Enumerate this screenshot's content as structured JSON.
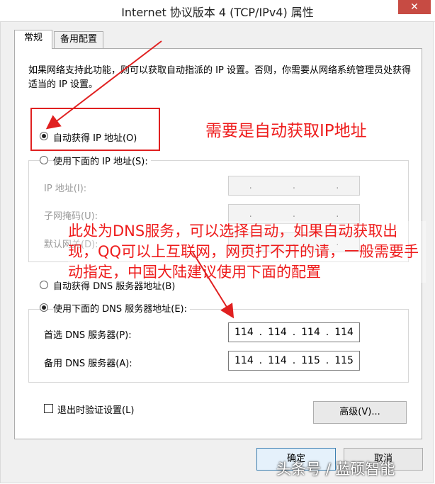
{
  "window": {
    "title": "Internet 协议版本 4 (TCP/IPv4) 属性",
    "close_glyph": "✕"
  },
  "tabs": [
    {
      "label": "常规",
      "active": true
    },
    {
      "label": "备用配置",
      "active": false
    }
  ],
  "description": "如果网络支持此功能，则可以获取自动指派的 IP 设置。否则，你需要从网络系统管理员处获得适当的 IP 设置。",
  "ip": {
    "auto_label": "自动获得 IP 地址(O)",
    "auto_selected": true,
    "manual_label": "使用下面的 IP 地址(S):",
    "manual_selected": false,
    "fields": [
      {
        "label": "IP 地址(I):",
        "value": "  .  .  ."
      },
      {
        "label": "子网掩码(U):",
        "value": "  .  .  ."
      },
      {
        "label": "默认网关(D):",
        "value": "  .  .  ."
      }
    ]
  },
  "dns": {
    "auto_label": "自动获得 DNS 服务器地址(B)",
    "auto_selected": false,
    "manual_label": "使用下面的 DNS 服务器地址(E):",
    "manual_selected": true,
    "preferred_label": "首选 DNS 服务器(P):",
    "preferred_octets": [
      "114",
      "114",
      "114",
      "114"
    ],
    "alternate_label": "备用 DNS 服务器(A):",
    "alternate_octets": [
      "114",
      "114",
      "115",
      "115"
    ]
  },
  "validate_label": "退出时验证设置(L)",
  "validate_checked": false,
  "advanced_label": "高级(V)...",
  "ok_label": "确定",
  "cancel_label": "取消",
  "annotations": {
    "top": "需要是自动获取IP地址",
    "middle": "此处为DNS服务，可以选择自动，如果自动获取出现，QQ可以上互联网，网页打不开的请，一般需要手动指定，中国大陆建议使用下面的配置",
    "color": "#ee1c1c"
  },
  "watermark": "头条号 / 蓝硕智能"
}
